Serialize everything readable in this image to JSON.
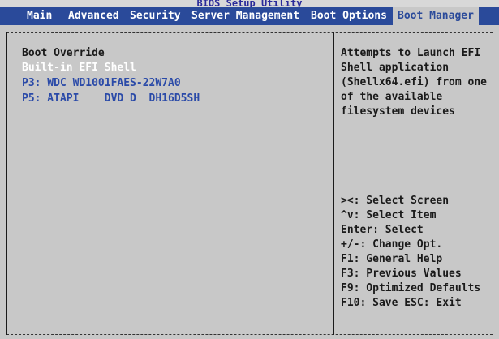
{
  "app": {
    "title": "BIOS Setup Utility"
  },
  "tabs": [
    {
      "label": "Main"
    },
    {
      "label": "Advanced"
    },
    {
      "label": "Security"
    },
    {
      "label": "Server Management"
    },
    {
      "label": "Boot Options"
    },
    {
      "label": "Boot Manager",
      "active": true
    }
  ],
  "main": {
    "heading": "Boot Override",
    "items": [
      {
        "label": "Built-in EFI Shell",
        "selected": true
      },
      {
        "label": "P3: WDC WD1001FAES-22W7A0"
      },
      {
        "label": "P5: ATAPI    DVD D  DH16D5SH"
      }
    ]
  },
  "help": {
    "description": [
      "Attempts to Launch EFI",
      "Shell application",
      "(Shellx64.efi) from one",
      "of the available",
      "filesystem devices"
    ],
    "keys": [
      "><: Select Screen",
      "^v: Select Item",
      "Enter: Select",
      "+/-: Change Opt.",
      "F1: General Help",
      "F3: Previous Values",
      "F9: Optimized Defaults",
      "F10: Save  ESC: Exit"
    ]
  },
  "colors": {
    "background": "#c8c8c8",
    "menubar": "#2a4a9a",
    "selected_text": "#ffffff",
    "item_text": "#2a4aa8",
    "normal_text": "#1a1a1a"
  }
}
